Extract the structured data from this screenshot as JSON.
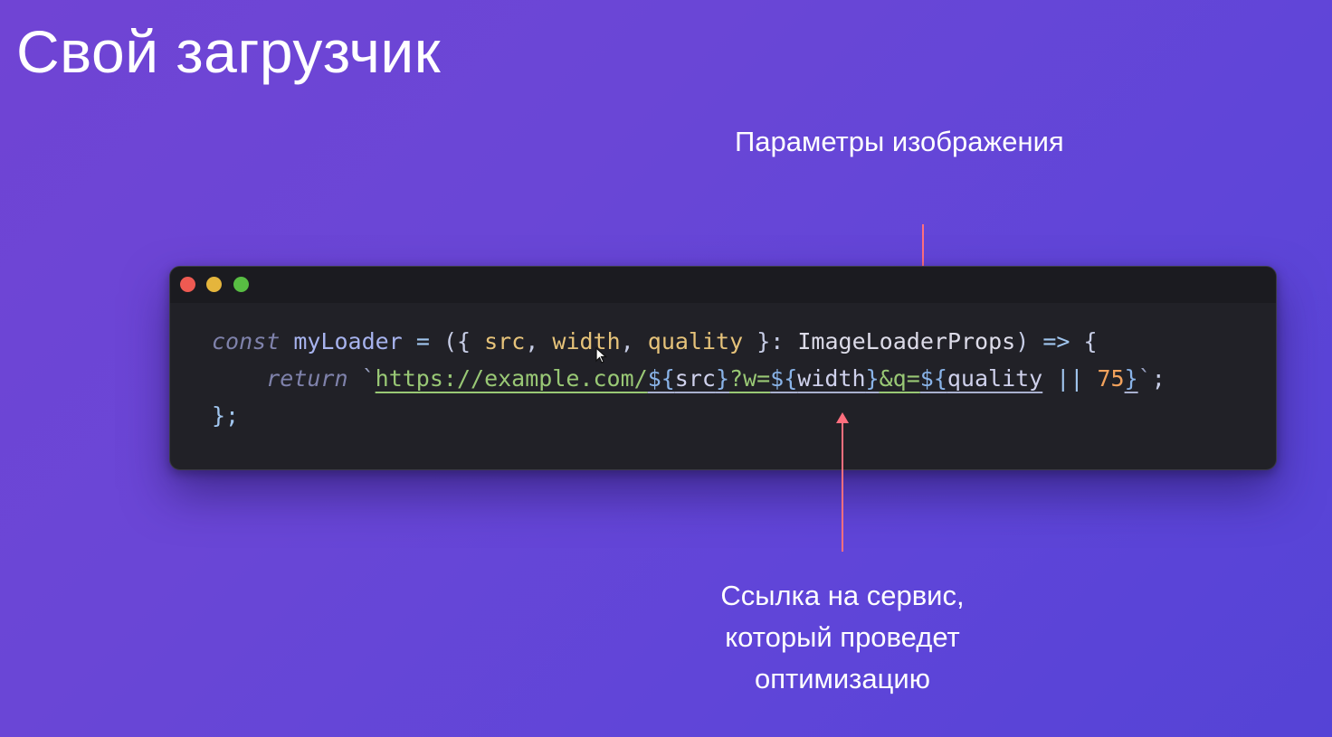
{
  "slide": {
    "title": "Свой загрузчик",
    "annotation_top": "Параметры изображения",
    "annotation_bottom": [
      "Ссылка на сервис,",
      "который проведет",
      "оптимизацию"
    ]
  },
  "code_window": {
    "window_controls": [
      "close",
      "minimize",
      "maximize"
    ],
    "lines": {
      "line1": {
        "const": "const",
        "name": "myLoader",
        "eq": "=",
        "open": "({",
        "src": "src",
        "comma1": ",",
        "width": "width",
        "comma2": ",",
        "quality": "quality",
        "close": "}:",
        "type": "ImageLoaderProps",
        "paren": ")",
        "arrow": "=>",
        "brace": "{"
      },
      "line2": {
        "return": "return",
        "tick_open": "`",
        "url": "https://example.com/",
        "i1_open": "${",
        "src": "src",
        "i1_close": "}",
        "q_w": "?w=",
        "i2_open": "${",
        "width": "width",
        "i2_close": "}",
        "amp_q": "&q=",
        "i3_open": "${",
        "quality": "quality",
        "or": "||",
        "default_value": "75",
        "i3_close": "}",
        "tick_close": "`",
        "semi": ";"
      },
      "line3": {
        "close": "};"
      }
    }
  },
  "colors": {
    "background_start": "#7044d4",
    "background_end": "#5543d6",
    "editor_background": "#212127",
    "arrow": "#ff6f7e",
    "close_light": "#ee5a52",
    "minimize_light": "#e5b53c",
    "maximize_light": "#58bd43"
  },
  "icons": {
    "cursor": "mouse-pointer-icon"
  }
}
